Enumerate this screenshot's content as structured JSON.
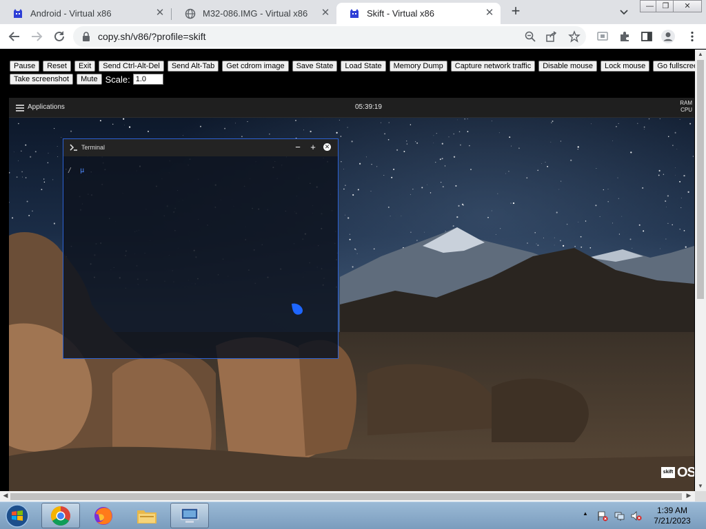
{
  "browser": {
    "tabs": [
      {
        "title": "Android - Virtual x86",
        "icon": "v86-logo-icon",
        "active": false
      },
      {
        "title": "M32-086.IMG - Virtual x86",
        "icon": "globe-icon",
        "active": false
      },
      {
        "title": "Skift - Virtual x86",
        "icon": "v86-logo-icon",
        "active": true
      }
    ],
    "new_tab_label": "+",
    "url": "copy.sh/v86/?profile=skift",
    "window_controls": {
      "minimize": "—",
      "restore": "❐",
      "close": "✕"
    }
  },
  "v86_controls": {
    "row1": [
      "Pause",
      "Reset",
      "Exit",
      "Send Ctrl-Alt-Del",
      "Send Alt-Tab",
      "Get cdrom image",
      "Save State",
      "Load State",
      "Memory Dump",
      "Capture network traffic",
      "Disable mouse",
      "Lock mouse",
      "Go fullscreen"
    ],
    "row2": [
      "Take screenshot",
      "Mute"
    ],
    "scale_label": "Scale:",
    "scale_value": "1.0"
  },
  "skift": {
    "applications_label": "Applications",
    "clock": "05:39:19",
    "ram_label": "RAM",
    "cpu_label": "CPU",
    "terminal": {
      "title": "Terminal",
      "prompt_path": "/",
      "prompt_symbol": "µ",
      "buttons": {
        "minimize": "−",
        "maximize": "+",
        "close": "✕"
      }
    },
    "logo_box": "skift",
    "logo_text": "OS"
  },
  "taskbar": {
    "time": "1:39 AM",
    "date": "7/21/2023",
    "items": [
      "chrome-icon",
      "firefox-icon",
      "file-explorer-icon",
      "remote-desktop-icon"
    ]
  }
}
